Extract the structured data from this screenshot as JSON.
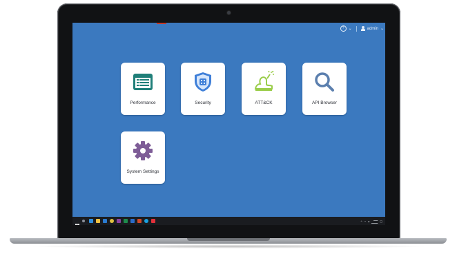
{
  "topbar": {
    "help_icon": "help-icon",
    "user_name": "admin",
    "user_icon": "user-icon"
  },
  "apps": [
    {
      "label": "Performance",
      "icon": "list-window-icon",
      "color": "#1f7f79"
    },
    {
      "label": "Security",
      "icon": "shield-icon",
      "color": "#3f7fd8"
    },
    {
      "label": "ATT&CK",
      "icon": "attack-bomb-icon",
      "color": "#9acd4a"
    },
    {
      "label": "API Browser",
      "icon": "magnifier-icon",
      "color": "#5b7fae"
    },
    {
      "label": "System Settings",
      "icon": "gear-icon",
      "color": "#7e5d97"
    }
  ],
  "taskbar": {
    "start_icon": "windows-start-icon",
    "pinned_icons": [
      "search-icon",
      "task-view-icon",
      "file-explorer-icon",
      "store-icon",
      "chrome-icon",
      "onenote-icon",
      "excel-icon",
      "word-icon",
      "powerpoint-icon",
      "skype-icon",
      "media-icon"
    ]
  },
  "colors": {
    "desktop": "#3b79bf",
    "tile": "#ffffff",
    "taskbar": "#1a1c20"
  }
}
